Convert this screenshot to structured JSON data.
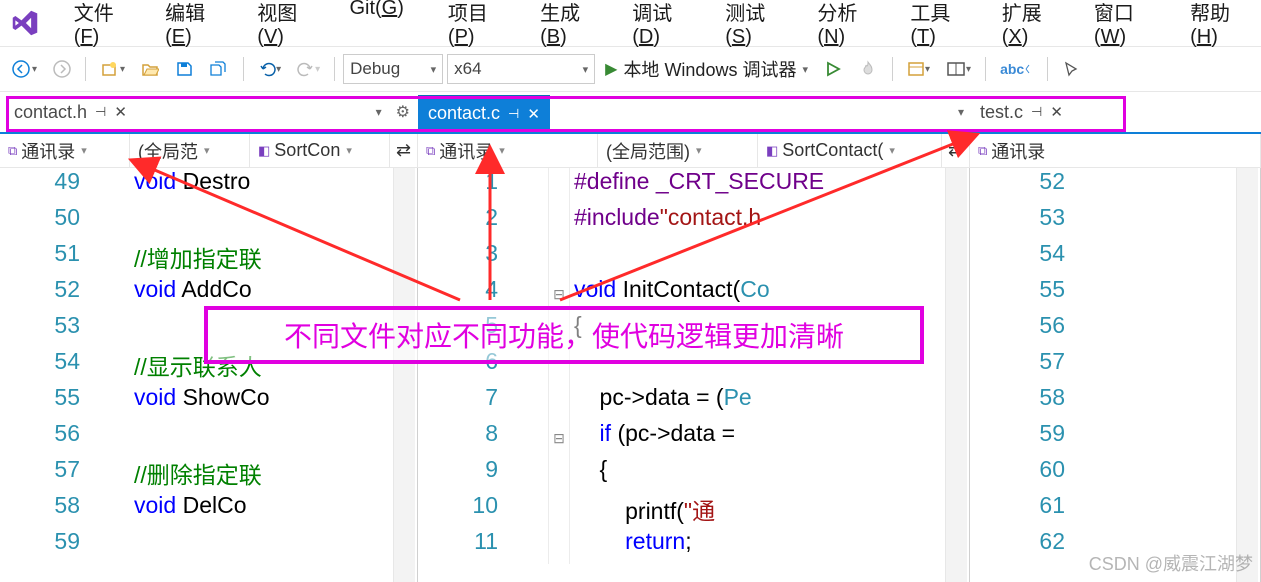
{
  "menu": [
    "文件(F)",
    "编辑(E)",
    "视图(V)",
    "Git(G)",
    "项目(P)",
    "生成(B)",
    "调试(D)",
    "测试(S)",
    "分析(N)",
    "工具(T)",
    "扩展(X)",
    "窗口(W)",
    "帮助(H)"
  ],
  "toolbar": {
    "config": "Debug",
    "platform": "x64",
    "debugger": "本地 Windows 调试器"
  },
  "tabs": {
    "left": {
      "name": "contact.h",
      "active": false
    },
    "middle": {
      "name": "contact.c",
      "active": true
    },
    "right": {
      "name": "test.c",
      "active": false
    }
  },
  "nav": {
    "p1": {
      "scope": "通讯录",
      "range": "(全局范",
      "member": "SortCon"
    },
    "p2": {
      "scope": "通讯录",
      "range": "(全局范围)",
      "member": "SortContact("
    },
    "p3": {
      "scope": "通讯录"
    }
  },
  "code": {
    "pane1": [
      {
        "n": 49,
        "seg": [
          {
            "c": "kw",
            "t": "void"
          },
          {
            "c": "",
            "t": " Destro"
          }
        ]
      },
      {
        "n": 50,
        "seg": []
      },
      {
        "n": 51,
        "seg": [
          {
            "c": "cmt",
            "t": "//增加指定联"
          }
        ]
      },
      {
        "n": 52,
        "seg": [
          {
            "c": "kw",
            "t": "void"
          },
          {
            "c": "",
            "t": " AddCo"
          }
        ]
      },
      {
        "n": 53,
        "seg": []
      },
      {
        "n": 54,
        "seg": [
          {
            "c": "cmt",
            "t": "//显示联系人"
          }
        ]
      },
      {
        "n": 55,
        "seg": [
          {
            "c": "kw",
            "t": "void"
          },
          {
            "c": "",
            "t": " ShowCo"
          }
        ]
      },
      {
        "n": 56,
        "seg": []
      },
      {
        "n": 57,
        "seg": [
          {
            "c": "cmt",
            "t": "//删除指定联"
          }
        ]
      },
      {
        "n": 58,
        "seg": [
          {
            "c": "kw",
            "t": "void"
          },
          {
            "c": "",
            "t": " DelCo"
          }
        ]
      },
      {
        "n": 59,
        "seg": []
      }
    ],
    "pane2": [
      {
        "n": 1,
        "f": "",
        "seg": [
          {
            "c": "mac",
            "t": "#define "
          },
          {
            "c": "mac",
            "t": "_CRT_SECURE"
          }
        ]
      },
      {
        "n": 2,
        "f": "",
        "seg": [
          {
            "c": "mac",
            "t": "#include"
          },
          {
            "c": "str",
            "t": "\"contact.h"
          }
        ]
      },
      {
        "n": 3,
        "f": "",
        "seg": []
      },
      {
        "n": 4,
        "f": "⊟",
        "seg": [
          {
            "c": "kw",
            "t": "void"
          },
          {
            "c": "",
            "t": " InitContact("
          },
          {
            "c": "typ",
            "t": "Co"
          }
        ]
      },
      {
        "n": 5,
        "f": "",
        "seg": [
          {
            "c": "",
            "t": "{"
          }
        ]
      },
      {
        "n": 6,
        "f": "",
        "seg": []
      },
      {
        "n": 7,
        "f": "",
        "seg": [
          {
            "c": "",
            "t": "    pc->data = ("
          },
          {
            "c": "typ",
            "t": "Pe"
          }
        ]
      },
      {
        "n": 8,
        "f": "⊟",
        "seg": [
          {
            "c": "kw",
            "t": "    if"
          },
          {
            "c": "",
            "t": " (pc->data ="
          }
        ]
      },
      {
        "n": 9,
        "f": "",
        "seg": [
          {
            "c": "",
            "t": "    {"
          }
        ]
      },
      {
        "n": 10,
        "f": "",
        "seg": [
          {
            "c": "",
            "t": "        printf("
          },
          {
            "c": "str",
            "t": "\"通"
          }
        ]
      },
      {
        "n": 11,
        "f": "",
        "seg": [
          {
            "c": "kw",
            "t": "        return"
          },
          {
            "c": "",
            "t": ";"
          }
        ]
      }
    ],
    "pane3": [
      {
        "n": 52
      },
      {
        "n": 53
      },
      {
        "n": 54
      },
      {
        "n": 55
      },
      {
        "n": 56
      },
      {
        "n": 57
      },
      {
        "n": 58
      },
      {
        "n": 59
      },
      {
        "n": 60
      },
      {
        "n": 61
      },
      {
        "n": 62
      }
    ]
  },
  "annotation": "不同文件对应不同功能，使代码逻辑更加清晰",
  "watermark": "CSDN @威震江湖梦"
}
